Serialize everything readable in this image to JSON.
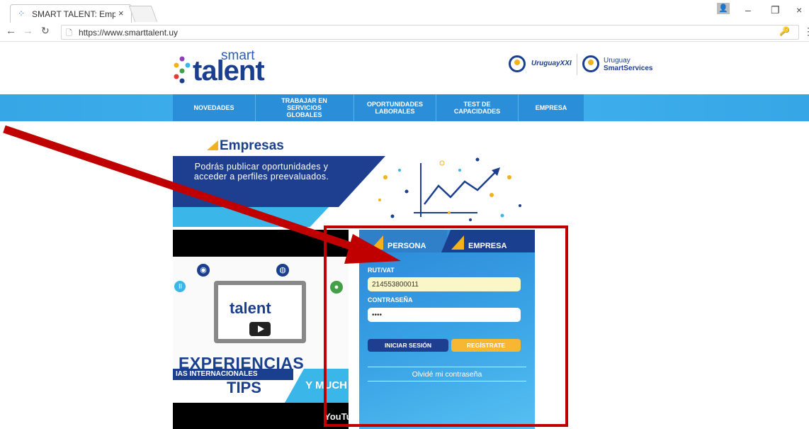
{
  "browser": {
    "tab_title": "SMART TALENT: Empresa",
    "tab_close": "×",
    "url": "https://www.smarttalent.uy",
    "controls": {
      "minimize": "–",
      "restore": "❐",
      "close": "×"
    }
  },
  "site": {
    "logo_small": "smart",
    "logo_big": "talent",
    "partner1": "UruguayXXI",
    "partner2_line1": "Uruguay",
    "partner2_line2": "SmartServices"
  },
  "nav": [
    {
      "label": "NOVEDADES"
    },
    {
      "label": "TRABAJAR EN SERVICIOS GLOBALES"
    },
    {
      "label": "OPORTUNIDADES LABORALES"
    },
    {
      "label": "TEST DE CAPACIDADES"
    },
    {
      "label": "EMPRESA"
    }
  ],
  "banner": {
    "heading": "Empresas",
    "text": "Podrás publicar oportunidades y acceder a perfiles preevaluados."
  },
  "video": {
    "logo": "talent",
    "headline": "EXPERIENCIAS",
    "band_text": "IAS INTERNACIONALES",
    "tips": "TIPS",
    "more": "Y MUCH",
    "youtube": "YouTube"
  },
  "login": {
    "tab_persona": "PERSONA",
    "tab_empresa": "EMPRESA",
    "rut_label": "RUT/VAT",
    "rut_value": "214553800011",
    "password_label": "CONTRASEÑA",
    "password_value": "••••",
    "login_button": "INICIAR SESIÓN",
    "register_button": "REGÍSTRATE",
    "forgot": "Olvidé mi contraseña"
  },
  "colors": {
    "annotation": "#c00000",
    "brand_dark": "#1b3f8f",
    "brand_light": "#3ab6e9",
    "accent": "#f2b21b"
  }
}
